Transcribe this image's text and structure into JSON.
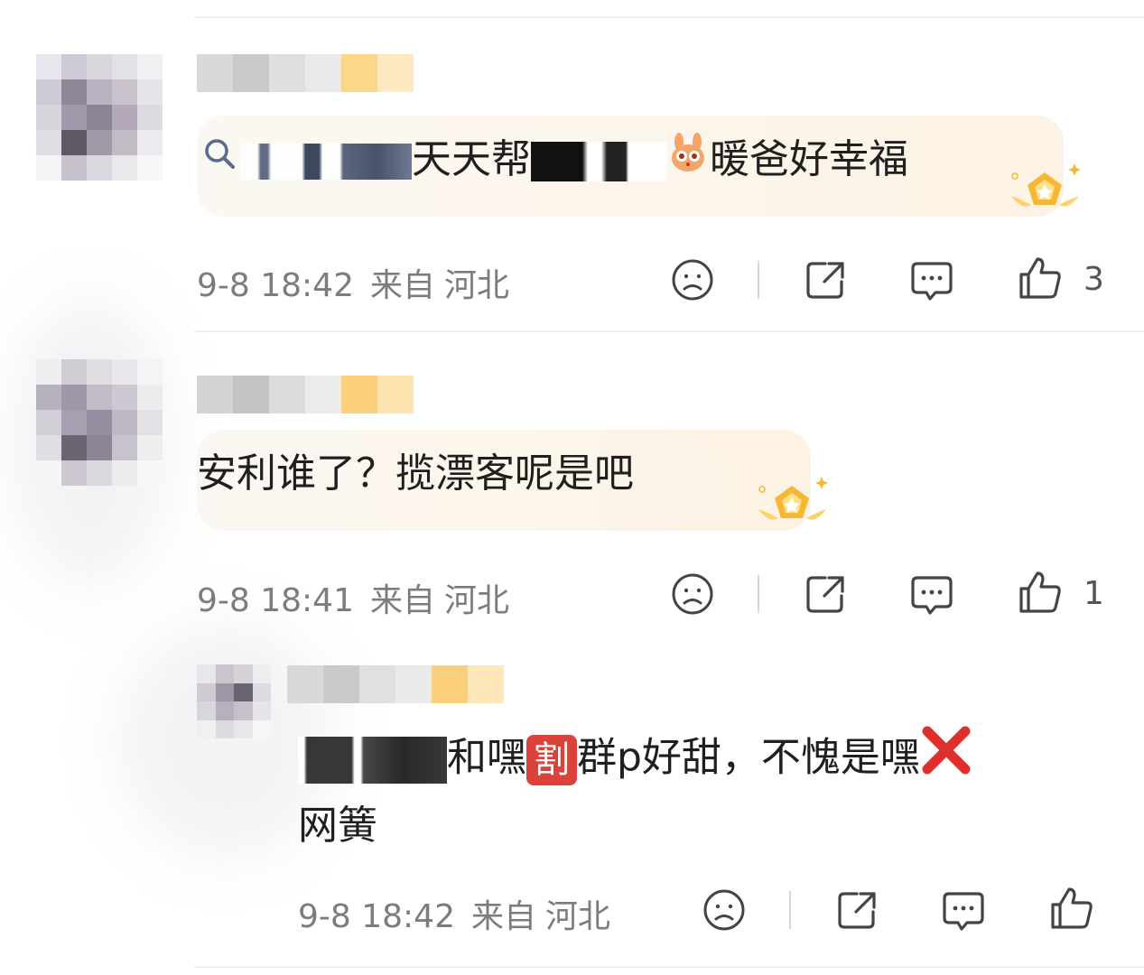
{
  "comments": [
    {
      "text_parts": [
        "天天帮",
        "暖爸好幸福"
      ],
      "inline_emoji": "rabbit-sticker",
      "search_icon": "search-icon",
      "time": "9-8 18:42",
      "location_prefix": "来自",
      "location": "河北",
      "like_count": "3"
    },
    {
      "text": "安利谁了？揽漂客呢是吧",
      "time": "9-8 18:41",
      "location_prefix": "来自",
      "location": "河北",
      "like_count": "1"
    }
  ],
  "reply": {
    "text_line1_a": "和嘿",
    "badge_char": "割",
    "text_line1_b": "群p好甜，不愧是嘿",
    "cross_icon": "cross-mark-icon",
    "text_line2": "网簧",
    "time": "9-8 18:42",
    "location_prefix": "来自",
    "location": "河北"
  },
  "colors": {
    "meta_text": "#7c7c7c",
    "bubble": "#fdf3e4",
    "badge_gold": "#f7b733",
    "cross_red": "#e0302e",
    "divider": "#eeeeee"
  }
}
